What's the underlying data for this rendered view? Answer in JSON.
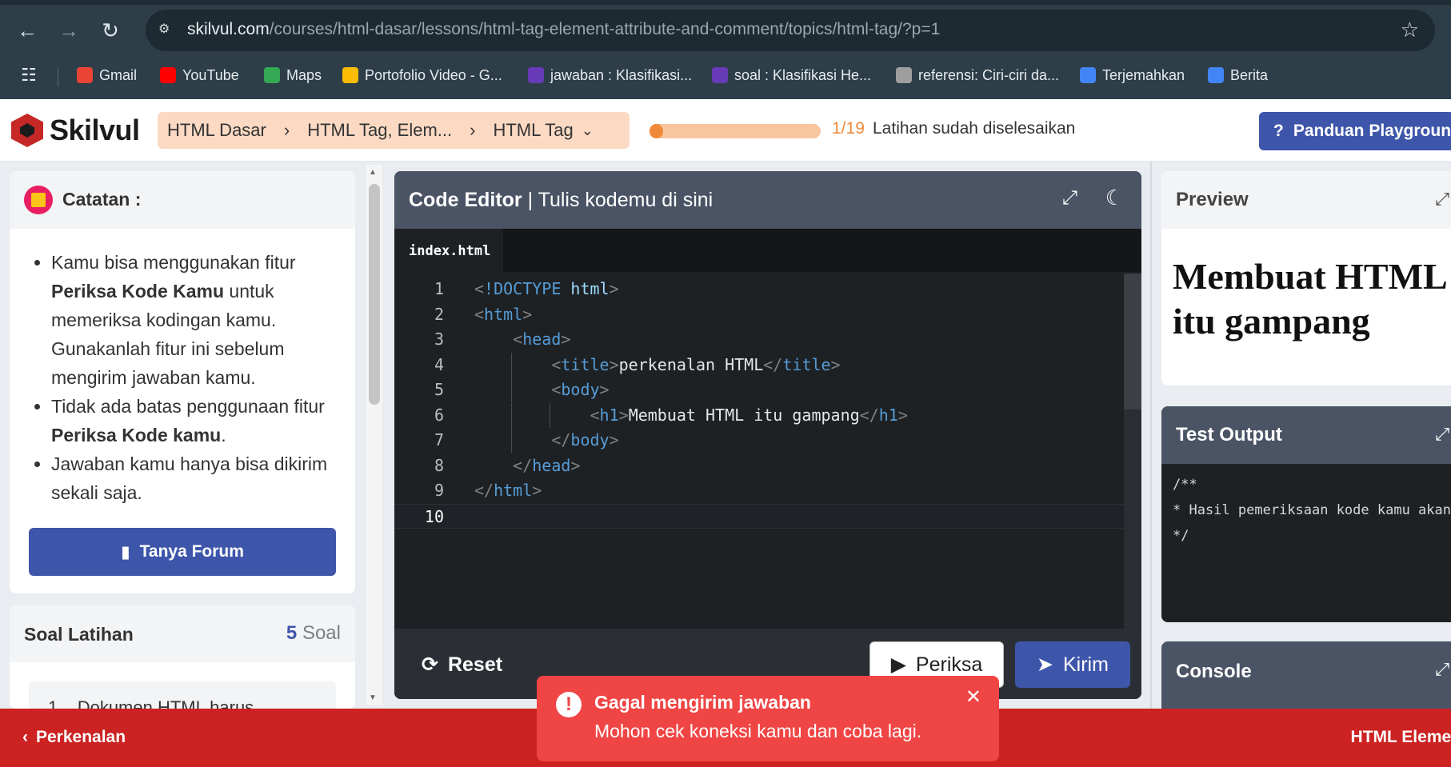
{
  "browser": {
    "url_host": "skilvul.com",
    "url_path": "/courses/html-dasar/lessons/html-tag-element-attribute-and-comment/topics/html-tag/?p=1",
    "bookmarks": [
      {
        "label": "Gmail",
        "icon": "gmail-icon",
        "color": "#ea4335"
      },
      {
        "label": "YouTube",
        "icon": "youtube-icon",
        "color": "#ff0000"
      },
      {
        "label": "Maps",
        "icon": "maps-icon",
        "color": "#34a853"
      },
      {
        "label": "Portofolio Video - G...",
        "icon": "drive-icon",
        "color": "#fbbc04"
      },
      {
        "label": "jawaban : Klasifikasi...",
        "icon": "forms-icon",
        "color": "#673ab7"
      },
      {
        "label": "soal : Klasifikasi He...",
        "icon": "forms-icon",
        "color": "#673ab7"
      },
      {
        "label": "referensi: Ciri-ciri da...",
        "icon": "globe-icon",
        "color": "#9e9e9e"
      },
      {
        "label": "Terjemahkan",
        "icon": "translate-icon",
        "color": "#4285f4"
      },
      {
        "label": "Berita",
        "icon": "news-icon",
        "color": "#4285f4"
      }
    ]
  },
  "header": {
    "logo_text": "Skilvul",
    "breadcrumb": [
      "HTML Dasar",
      "HTML Tag, Elem...",
      "HTML Tag"
    ],
    "progress": {
      "done": 1,
      "total": 19,
      "label": "1/19"
    },
    "progress_text": "Latihan sudah diselesaikan",
    "guide_button": "Panduan Playground",
    "accent": "#3e56aa"
  },
  "notes": {
    "title": "Catatan :",
    "items": [
      {
        "pre": "Kamu bisa menggunakan fitur ",
        "bold": "Periksa Kode Kamu",
        "post": " untuk memeriksa kodingan kamu. Gunakanlah fitur ini sebelum mengirim jawaban kamu."
      },
      {
        "pre": "Tidak ada batas penggunaan fitur ",
        "bold": "Periksa Kode kamu",
        "post": "."
      },
      {
        "pre": "Jawaban kamu hanya bisa dikirim sekali saja.",
        "bold": "",
        "post": ""
      }
    ],
    "forum_button": "Tanya Forum"
  },
  "soal": {
    "title": "Soal Latihan",
    "count_num": "5",
    "count_label": "Soal",
    "first_item_num": "1",
    "first_item_text": "Dokumen HTML harus"
  },
  "editor": {
    "title_bold": "Code Editor",
    "title_rest": " | Tulis kodemu di sini",
    "tab": "index.html",
    "lines": [
      "<!DOCTYPE html>",
      "<html>",
      "    <head>",
      "        <title>perkenalan HTML</title>",
      "        <body>",
      "            <h1>Membuat HTML itu gampang</h1>",
      "        </body>",
      "    </head>",
      "</html>",
      ""
    ],
    "reset": "Reset",
    "check": "Periksa",
    "submit": "Kirim"
  },
  "preview": {
    "title": "Preview",
    "heading": "Membuat HTML itu gampang"
  },
  "test_output": {
    "title": "Test Output",
    "text": "/**\n* Hasil pemeriksaan kode kamu akan muncul di sini\n*/"
  },
  "console": {
    "title": "Console"
  },
  "footer": {
    "prev": "Perkenalan",
    "next": "HTML Element"
  },
  "toast": {
    "title": "Gagal mengirim jawaban",
    "message": "Mohon cek koneksi kamu dan coba lagi.",
    "color": "#f04545"
  }
}
